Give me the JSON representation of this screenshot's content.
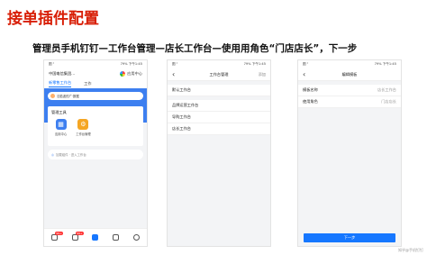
{
  "title": "接单插件配置",
  "subtitle": "管理员手机钉钉—工作台管理—店长工作台—使用用角色“门店店长”，下一步",
  "status": {
    "carrier": "图 ᵃ",
    "right": "79% 下午1:45"
  },
  "phone1": {
    "org_name": "中国电信集团...",
    "apps_label": "应用中心",
    "tabs": [
      "新零售工作台",
      "工作"
    ],
    "user_text": "沈若波的广·数据",
    "card_title": "管理工具",
    "tiles": [
      {
        "label": "应用中心",
        "color": "#3d7ff0",
        "icon": "grid-icon"
      },
      {
        "label": "工作台管理",
        "color": "#f5a623",
        "icon": "gear-icon"
      }
    ],
    "tip": "加载组件 · 进入工作台",
    "bottom_badges": [
      "99+",
      "99+"
    ]
  },
  "phone2": {
    "nav_title": "工作台管理",
    "nav_right": "添加",
    "rows_top": [
      "默认工作台"
    ],
    "rows_bottom": [
      "品牌运营工作台",
      "导购工作台",
      "店长工作台"
    ]
  },
  "phone3": {
    "nav_title": "编辑模板",
    "rows": [
      {
        "label": "模板名称",
        "value": "店长工作台"
      },
      {
        "label": "使用角色",
        "value": "门店店长"
      }
    ],
    "button": "下一步"
  },
  "watermark": "知乎@手机钉钉"
}
